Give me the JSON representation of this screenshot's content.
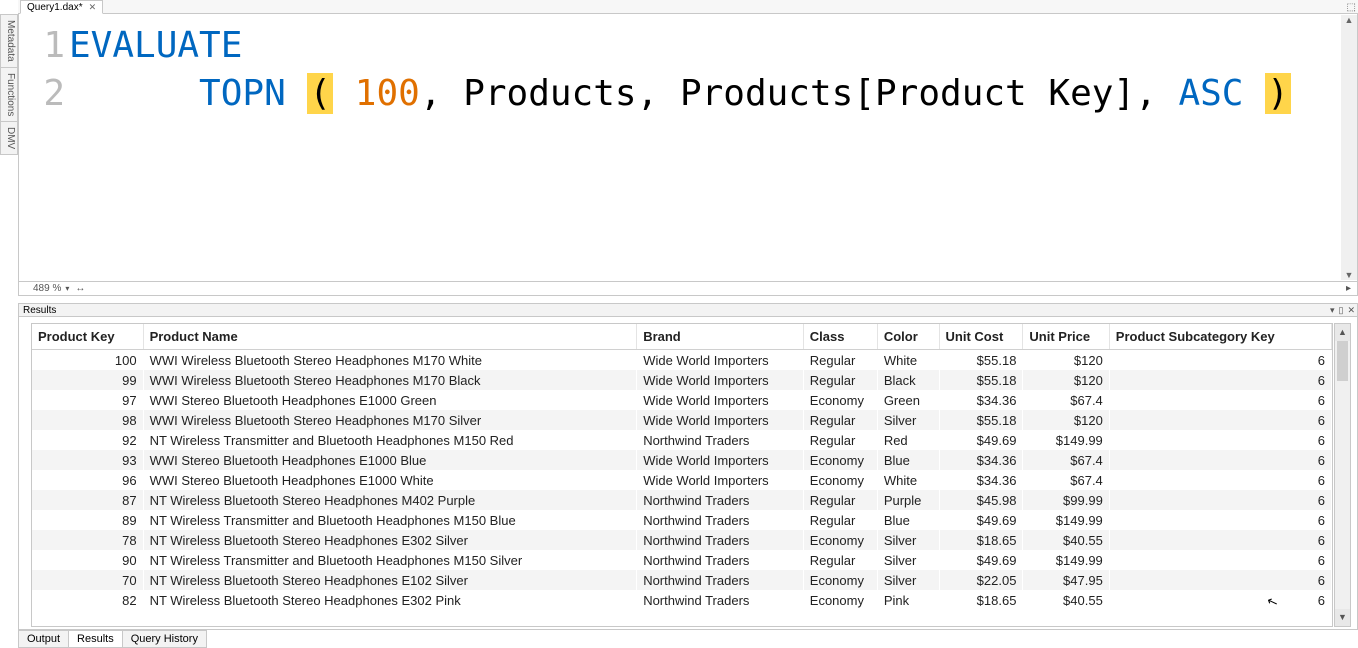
{
  "filetab": {
    "name": "Query1.dax*"
  },
  "vtabs": [
    "Metadata",
    "Functions",
    "DMV"
  ],
  "top_right_glyph": "⬚",
  "code": {
    "line1_num": "1",
    "line2_num": "2",
    "l1_evaluate": "EVALUATE",
    "l2_indent": "      ",
    "l2_topn": "TOPN ",
    "l2_lp": "(",
    "l2_sp1": " ",
    "l2_n": "100",
    "l2_c1": ", ",
    "l2_t1": "Products",
    "l2_c2": ", ",
    "l2_t2": "Products[Product Key]",
    "l2_c3": ", ",
    "l2_asc": "ASC ",
    "l2_rp": ")"
  },
  "zoom": {
    "pct": "489 %",
    "dd": "▾",
    "harr": "↔",
    "right": "▸"
  },
  "results_title": "Results",
  "results_tools": {
    "dd": "▾",
    "pin": "▯",
    "x": "✕"
  },
  "scroll": {
    "up": "▲",
    "down": "▼"
  },
  "columns": [
    "Product Key",
    "Product Name",
    "Brand",
    "Class",
    "Color",
    "Unit Cost",
    "Unit Price",
    "Product Subcategory Key"
  ],
  "rows": [
    {
      "key": "100",
      "name": "WWI Wireless Bluetooth Stereo Headphones M170 White",
      "brand": "Wide World Importers",
      "class": "Regular",
      "color": "White",
      "cost": "$55.18",
      "price": "$120",
      "sub": "6"
    },
    {
      "key": "99",
      "name": "WWI Wireless Bluetooth Stereo Headphones M170 Black",
      "brand": "Wide World Importers",
      "class": "Regular",
      "color": "Black",
      "cost": "$55.18",
      "price": "$120",
      "sub": "6"
    },
    {
      "key": "97",
      "name": "WWI Stereo Bluetooth Headphones E1000 Green",
      "brand": "Wide World Importers",
      "class": "Economy",
      "color": "Green",
      "cost": "$34.36",
      "price": "$67.4",
      "sub": "6"
    },
    {
      "key": "98",
      "name": "WWI Wireless Bluetooth Stereo Headphones M170 Silver",
      "brand": "Wide World Importers",
      "class": "Regular",
      "color": "Silver",
      "cost": "$55.18",
      "price": "$120",
      "sub": "6"
    },
    {
      "key": "92",
      "name": "NT Wireless Transmitter and Bluetooth Headphones M150 Red",
      "brand": "Northwind Traders",
      "class": "Regular",
      "color": "Red",
      "cost": "$49.69",
      "price": "$149.99",
      "sub": "6"
    },
    {
      "key": "93",
      "name": "WWI Stereo Bluetooth Headphones E1000 Blue",
      "brand": "Wide World Importers",
      "class": "Economy",
      "color": "Blue",
      "cost": "$34.36",
      "price": "$67.4",
      "sub": "6"
    },
    {
      "key": "96",
      "name": "WWI Stereo Bluetooth Headphones E1000 White",
      "brand": "Wide World Importers",
      "class": "Economy",
      "color": "White",
      "cost": "$34.36",
      "price": "$67.4",
      "sub": "6"
    },
    {
      "key": "87",
      "name": "NT Wireless Bluetooth Stereo Headphones M402 Purple",
      "brand": "Northwind Traders",
      "class": "Regular",
      "color": "Purple",
      "cost": "$45.98",
      "price": "$99.99",
      "sub": "6"
    },
    {
      "key": "89",
      "name": "NT Wireless Transmitter and Bluetooth Headphones M150 Blue",
      "brand": "Northwind Traders",
      "class": "Regular",
      "color": "Blue",
      "cost": "$49.69",
      "price": "$149.99",
      "sub": "6"
    },
    {
      "key": "78",
      "name": "NT Wireless Bluetooth Stereo Headphones E302 Silver",
      "brand": "Northwind Traders",
      "class": "Economy",
      "color": "Silver",
      "cost": "$18.65",
      "price": "$40.55",
      "sub": "6"
    },
    {
      "key": "90",
      "name": "NT Wireless Transmitter and Bluetooth Headphones M150 Silver",
      "brand": "Northwind Traders",
      "class": "Regular",
      "color": "Silver",
      "cost": "$49.69",
      "price": "$149.99",
      "sub": "6"
    },
    {
      "key": "70",
      "name": "NT Wireless Bluetooth Stereo Headphones E102 Silver",
      "brand": "Northwind Traders",
      "class": "Economy",
      "color": "Silver",
      "cost": "$22.05",
      "price": "$47.95",
      "sub": "6"
    },
    {
      "key": "82",
      "name": "NT Wireless Bluetooth Stereo Headphones E302 Pink",
      "brand": "Northwind Traders",
      "class": "Economy",
      "color": "Pink",
      "cost": "$18.65",
      "price": "$40.55",
      "sub": "6"
    }
  ],
  "bottom_tabs": [
    "Output",
    "Results",
    "Query History"
  ],
  "bottom_active": 1,
  "colwidths": [
    "90px",
    "400px",
    "135px",
    "60px",
    "50px",
    "68px",
    "70px",
    "180px"
  ]
}
